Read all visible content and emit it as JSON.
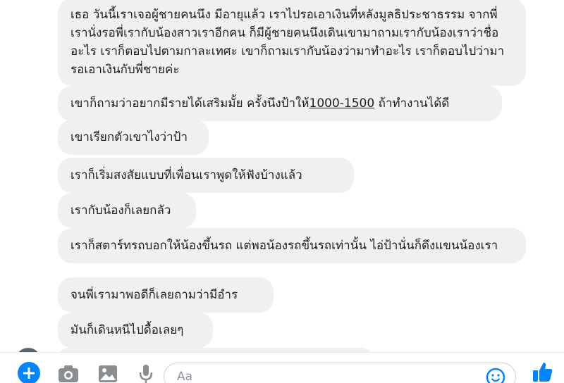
{
  "thread": {
    "messages": [
      {
        "text": "เธอ วันนี้เราเจอผู้ชายคนนึง มีอายุแล้ว เราไปรอเอาเงินที่หลังมูลธิประชาธรรม จากพี่ เรานั่งรอพี่เรากับน้องสาวเราอีกคน ก็มีผู้ชายคนนึงเดินเขามาถามเรากับน้องเราว่าชื่ออะไร เราก็ตอบไปตามกาละเทศะ เขาก็ถามเรากับน้องว่ามาทำอะไร เราก็ตอบไปว่ามารอเอาเงินกับพี่ชายค่ะ"
      },
      {
        "text_before": "เขาก็ถามว่าอยากมีรายได้เสริมมั้ย ครั้งนึงป้าให้",
        "underlined": "1000-1500",
        "text_after": " ถ้าทำงานได้ดี"
      },
      {
        "text": "เขาเรียกตัวเขาไงว่าป้า"
      },
      {
        "text": "เราก็เริ่มสงสัยแบบที่เพื่อนเราพูดให้ฟังบ้างแล้ว"
      },
      {
        "text": "เรากับน้องก็เลยกลัว"
      },
      {
        "text": "เราก็สตาร์ทรถบอกให้น้องขึ้นรถ แต่พอน้องรถขึ้นรถเท่านั้น ไอ่ป้านั่นก็ดึงแขนน้องเรา"
      },
      {
        "text": "จนพี่เรามาพอดีก็เลยถามว่ามีอำร"
      },
      {
        "text": "มันก็เดินหนีไปดื้อเลยๆ"
      }
    ]
  },
  "composer": {
    "placeholder": "Aa",
    "value": "",
    "icons": [
      "plus-icon",
      "camera-icon",
      "image-icon",
      "microphone-icon",
      "smiley-icon",
      "thumbs-up-icon"
    ],
    "accent": "#0084ff"
  }
}
